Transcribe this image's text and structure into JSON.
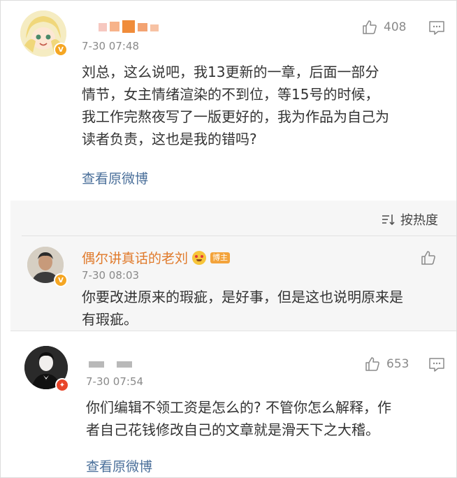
{
  "comment1": {
    "time": "7-30 07:48",
    "likes": "408",
    "lines": [
      "刘总，这么说吧，我13更新的一章，后面一部分",
      "情节，女主情绪渲染的不到位，等15号的时候，",
      "我工作完熬夜写了一版更好的，我为作品为自己为",
      "读者负责，这也是我的错吗?"
    ],
    "view_link": "查看原微博"
  },
  "sort": {
    "label": "按热度"
  },
  "reply": {
    "name": "偶尔讲真话的老刘",
    "tag": "博主",
    "time": "7-30 08:03",
    "lines": [
      "你要改进原来的瑕疵，是好事，但是这也说明原来是",
      "有瑕疵。"
    ]
  },
  "comment2": {
    "time": "7-30 07:54",
    "likes": "653",
    "lines": [
      "你们编辑不领工资是怎么的? 不管你怎么解释，作",
      "者自己花钱修改自己的文章就是滑天下之大稽。"
    ],
    "view_link": "查看原微博"
  },
  "colors": {
    "link": "#4a6f9a",
    "reply_name": "#e07a2b",
    "text": "#333333",
    "muted": "#8a8a8a",
    "section_bg": "#f6f6f6"
  },
  "icons": [
    "thumbs-up-icon",
    "comment-icon",
    "sort-icon",
    "verified-icon",
    "emoji-icon"
  ]
}
